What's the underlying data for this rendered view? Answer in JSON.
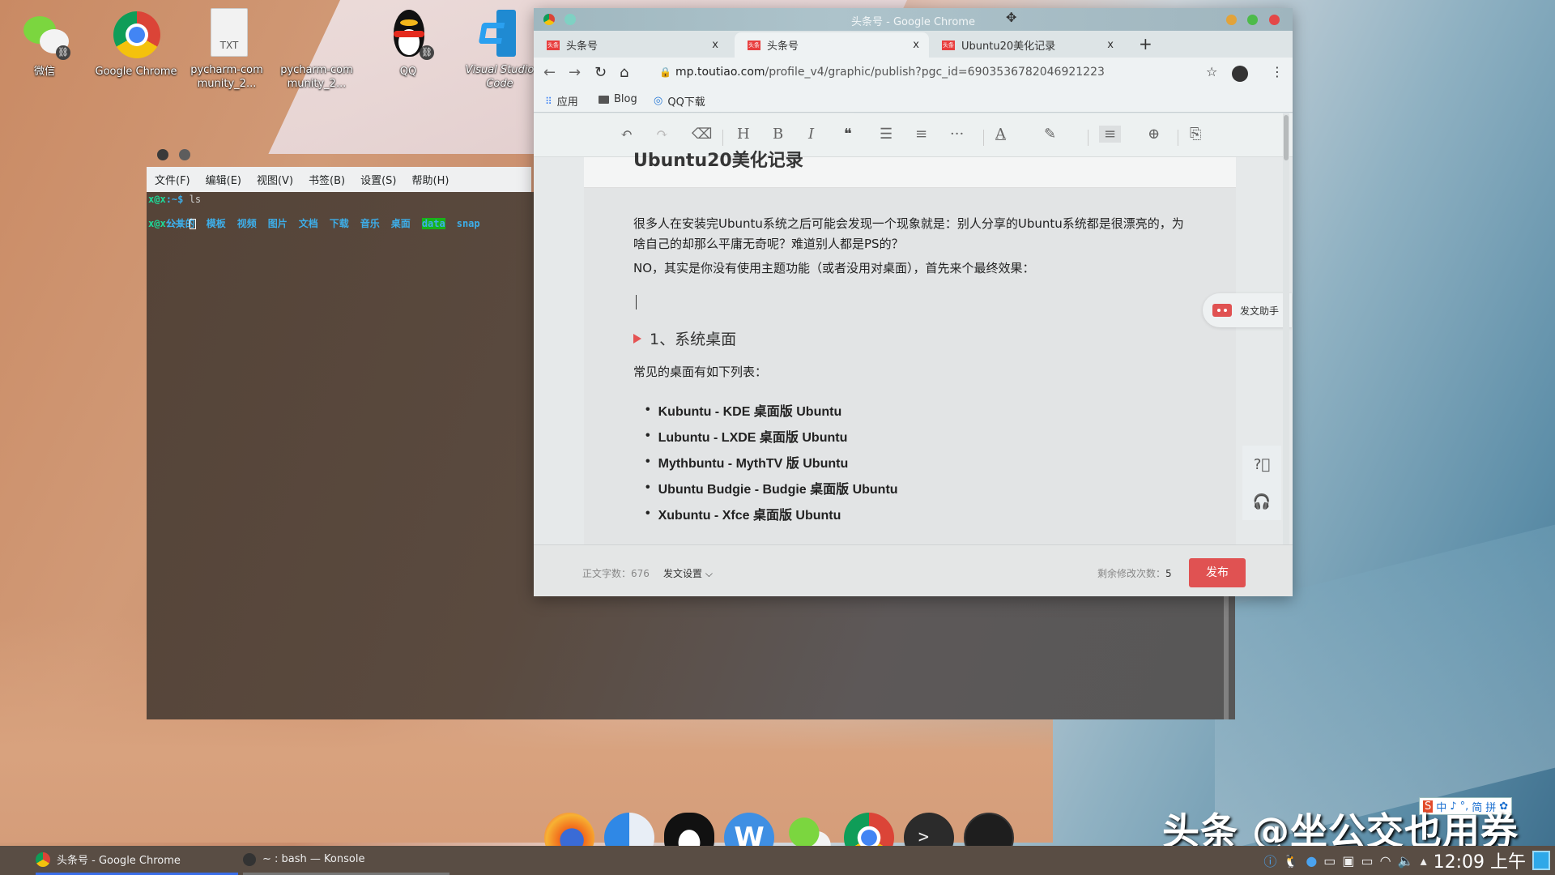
{
  "desktop": {
    "icons": [
      {
        "label": "微信",
        "icon": "wechat-icon"
      },
      {
        "label": "Google Chrome",
        "icon": "chrome-icon"
      },
      {
        "label": "pycharm-community_2...",
        "icon": "txt-file-icon",
        "badge": "TXT"
      },
      {
        "label": "pycharm-community_2...",
        "icon": "file-icon"
      },
      {
        "label": "QQ",
        "icon": "qq-icon"
      },
      {
        "label": "Visual Studio Code",
        "icon": "vscode-icon"
      }
    ]
  },
  "konsole": {
    "menu": [
      "文件(F)",
      "编辑(E)",
      "视图(V)",
      "书签(B)",
      "设置(S)",
      "帮助(H)"
    ],
    "prompt_user": "x@x",
    "prompt_path": ":~$",
    "command": " ls",
    "listing": [
      "公共的",
      "模板",
      "视频",
      "图片",
      "文档",
      "下载",
      "音乐",
      "桌面"
    ],
    "listing_highlight": "data",
    "listing_last": "snap"
  },
  "chrome": {
    "window_title": "头条号 - Google Chrome",
    "tabs": [
      {
        "title": "头条号",
        "favicon": "头条",
        "close": "x"
      },
      {
        "title": "头条号",
        "favicon": "头条",
        "close": "x",
        "active": true
      },
      {
        "title": "Ubuntu20美化记录",
        "favicon": "头条",
        "close": "x"
      }
    ],
    "new_tab": "+",
    "url_host": "mp.toutiao.com",
    "url_path": "/profile_v4/graphic/publish?pgc_id=6903536782046921223",
    "bookmarks": [
      {
        "label": "应用",
        "icon": "apps-grid-icon"
      },
      {
        "label": "Blog",
        "icon": "folder-icon"
      },
      {
        "label": "QQ下载",
        "icon": "qq-download-icon"
      }
    ]
  },
  "editor": {
    "toolbar": {
      "undo": "↶",
      "redo": "↷",
      "clear": "⌫",
      "heading": "H",
      "bold": "B",
      "italic": "I",
      "quote": "❝",
      "bullet_list": "☰",
      "ordered_list": "≡",
      "more": "···",
      "font_color": "A",
      "highlight": "✎",
      "align": "≡",
      "insert": "⊕",
      "export": "⎘"
    },
    "title_peek": "Ubuntu20美化记录",
    "paragraphs": [
      "很多人在安装完Ubuntu系统之后可能会发现一个现象就是：别人分享的Ubuntu系统都是很漂亮的，为啥自己的却那么平庸无奇呢？难道别人都是PS的？",
      "NO，其实是你没有使用主题功能（或者没用对桌面），首先来个最终效果："
    ],
    "heading": "1、系统桌面",
    "list_intro": "常见的桌面有如下列表：",
    "list": [
      "Kubuntu - KDE 桌面版 Ubuntu",
      "Lubuntu - LXDE 桌面版 Ubuntu",
      "Mythbuntu - MythTV 版 Ubuntu",
      "Ubuntu Budgie - Budgie 桌面版 Ubuntu",
      "Xubuntu - Xfce 桌面版 Ubuntu"
    ],
    "helper_label": "发文助手",
    "word_count_label": "正文字数：",
    "word_count": "676",
    "settings_label": "发文设置",
    "remaining_label": "剩余修改次数：",
    "remaining": "5",
    "publish_label": "发布",
    "accent": "#e05252"
  },
  "dock": {
    "apps": [
      "firefox-icon",
      "finder-icon",
      "qq-icon",
      "wps-icon",
      "wechat-icon",
      "chrome-icon",
      "terminal-icon",
      "clock-icon"
    ]
  },
  "taskbar": {
    "tasks": [
      {
        "label": "头条号 - Google Chrome",
        "icon": "chrome-icon"
      },
      {
        "label": "~ : bash — Konsole",
        "icon": "terminal-icon"
      }
    ],
    "clock": "12:09 上午"
  },
  "watermark": "头条 @坐公交也用券",
  "ime": [
    "中",
    "♪",
    "°,",
    "简",
    "拼",
    "✿"
  ]
}
